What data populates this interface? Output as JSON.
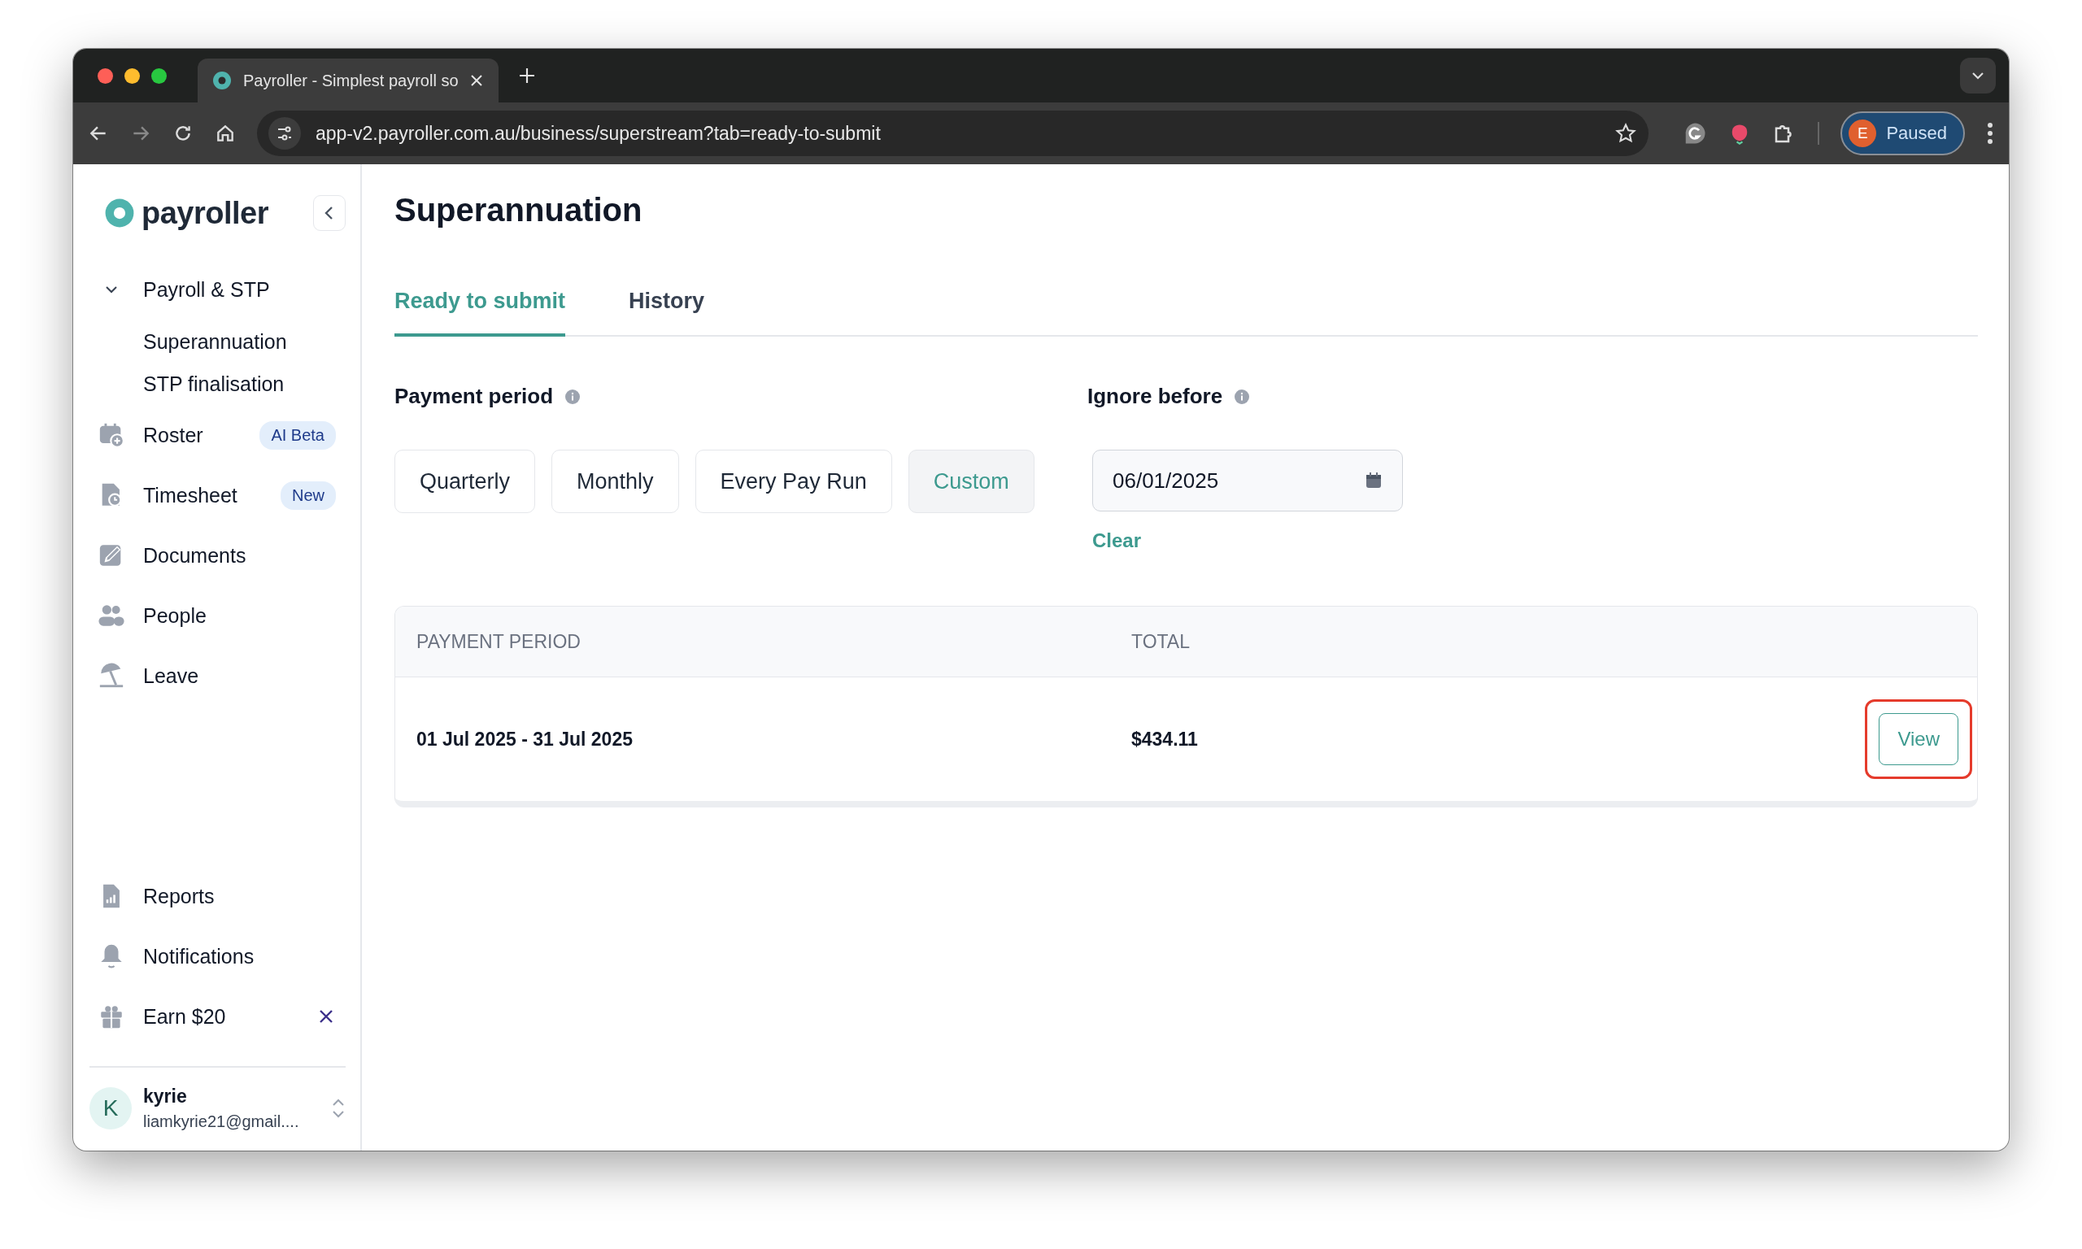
{
  "browser": {
    "tabs": [
      {
        "title": "Payroller - Simplest payroll so",
        "selected": true
      }
    ],
    "url": "app-v2.payroller.com.au/business/superstream?tab=ready-to-submit",
    "profile": {
      "initial": "E",
      "label": "Paused"
    }
  },
  "sidebar": {
    "logo": "payroller",
    "nav": [
      {
        "label": "Payroll & STP",
        "expanded": true,
        "children": [
          {
            "label": "Superannuation"
          },
          {
            "label": "STP finalisation"
          }
        ]
      },
      {
        "label": "Roster",
        "badge": "AI Beta"
      },
      {
        "label": "Timesheet",
        "badge": "New"
      },
      {
        "label": "Documents"
      },
      {
        "label": "People"
      },
      {
        "label": "Leave"
      }
    ],
    "bottom_nav": [
      {
        "label": "Reports"
      },
      {
        "label": "Notifications"
      },
      {
        "label": "Earn $20",
        "dismissible": true
      }
    ],
    "user": {
      "initial": "K",
      "name": "kyrie",
      "email": "liamkyrie21@gmail...."
    }
  },
  "main": {
    "title": "Superannuation",
    "tabs": [
      {
        "label": "Ready to submit",
        "selected": true
      },
      {
        "label": "History",
        "selected": false
      }
    ],
    "payment_period": {
      "label": "Payment period",
      "options": [
        {
          "label": "Quarterly",
          "selected": false
        },
        {
          "label": "Monthly",
          "selected": false
        },
        {
          "label": "Every Pay Run",
          "selected": false
        },
        {
          "label": "Custom",
          "selected": true
        }
      ]
    },
    "ignore_before": {
      "label": "Ignore before",
      "value": "06/01/2025",
      "clear": "Clear"
    },
    "table": {
      "columns": [
        "PAYMENT PERIOD",
        "TOTAL"
      ],
      "rows": [
        {
          "period": "01 Jul 2025 - 31 Jul 2025",
          "total": "$434.11",
          "action": "View",
          "highlighted": true
        }
      ]
    }
  }
}
